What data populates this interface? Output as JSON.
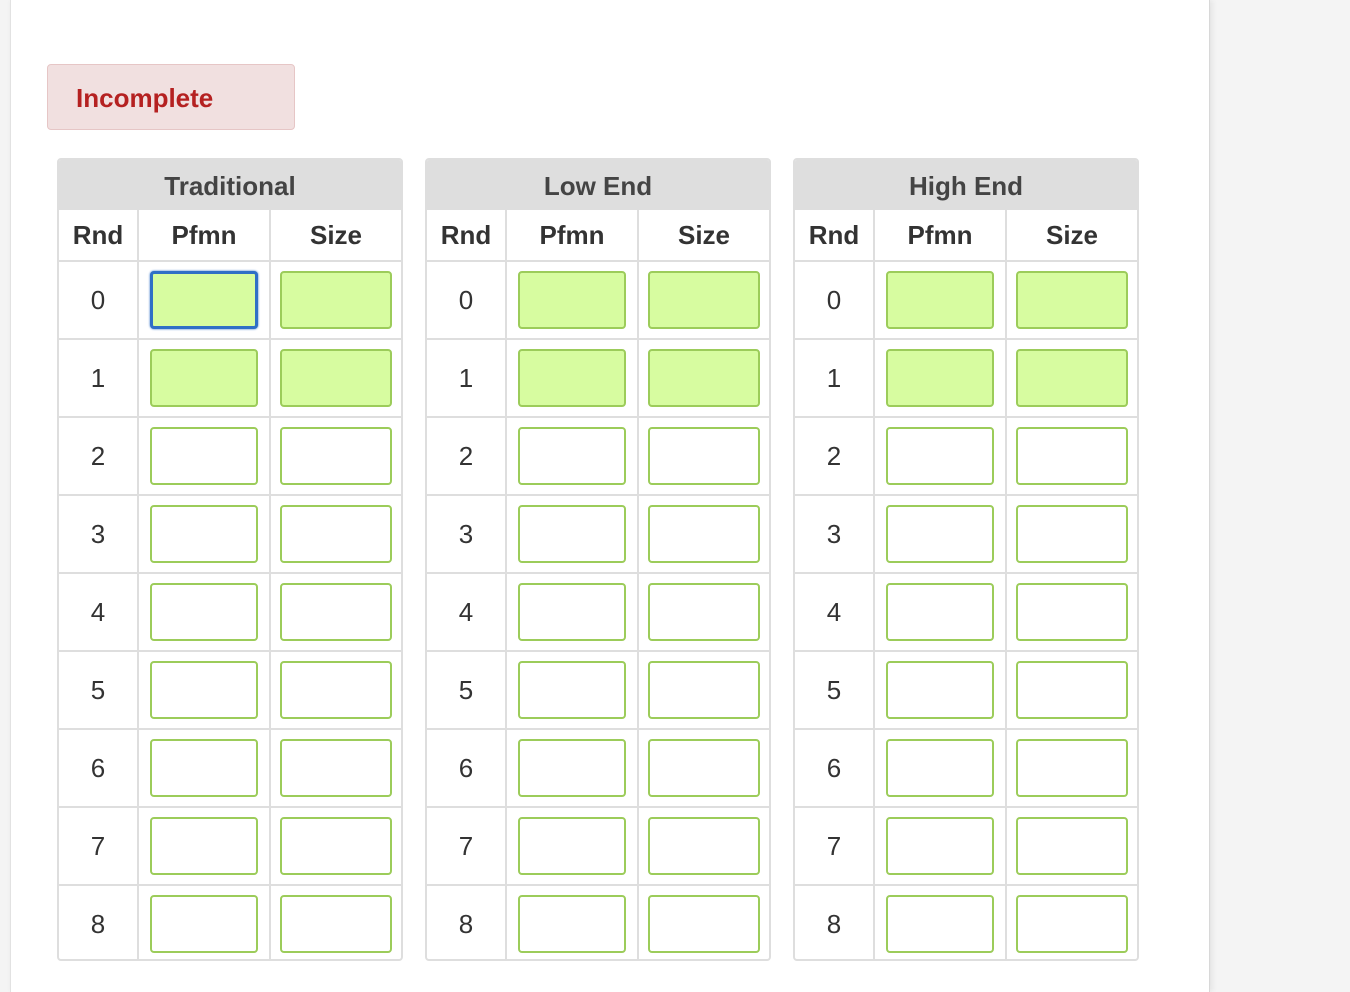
{
  "status": {
    "label": "Incomplete",
    "color": "#b52121"
  },
  "column_headers": {
    "rnd": "Rnd",
    "pfmn": "Pfmn",
    "size": "Size"
  },
  "segments": [
    {
      "title": "Traditional",
      "rows": [
        {
          "rnd": "0",
          "pfmn": "",
          "size": "",
          "highlighted": true,
          "focused_field": "pfmn"
        },
        {
          "rnd": "1",
          "pfmn": "",
          "size": "",
          "highlighted": true
        },
        {
          "rnd": "2",
          "pfmn": "",
          "size": "",
          "highlighted": false
        },
        {
          "rnd": "3",
          "pfmn": "",
          "size": "",
          "highlighted": false
        },
        {
          "rnd": "4",
          "pfmn": "",
          "size": "",
          "highlighted": false
        },
        {
          "rnd": "5",
          "pfmn": "",
          "size": "",
          "highlighted": false
        },
        {
          "rnd": "6",
          "pfmn": "",
          "size": "",
          "highlighted": false
        },
        {
          "rnd": "7",
          "pfmn": "",
          "size": "",
          "highlighted": false
        },
        {
          "rnd": "8",
          "pfmn": "",
          "size": "",
          "highlighted": false
        }
      ]
    },
    {
      "title": "Low End",
      "rows": [
        {
          "rnd": "0",
          "pfmn": "",
          "size": "",
          "highlighted": true
        },
        {
          "rnd": "1",
          "pfmn": "",
          "size": "",
          "highlighted": true
        },
        {
          "rnd": "2",
          "pfmn": "",
          "size": "",
          "highlighted": false
        },
        {
          "rnd": "3",
          "pfmn": "",
          "size": "",
          "highlighted": false
        },
        {
          "rnd": "4",
          "pfmn": "",
          "size": "",
          "highlighted": false
        },
        {
          "rnd": "5",
          "pfmn": "",
          "size": "",
          "highlighted": false
        },
        {
          "rnd": "6",
          "pfmn": "",
          "size": "",
          "highlighted": false
        },
        {
          "rnd": "7",
          "pfmn": "",
          "size": "",
          "highlighted": false
        },
        {
          "rnd": "8",
          "pfmn": "",
          "size": "",
          "highlighted": false
        }
      ]
    },
    {
      "title": "High End",
      "rows": [
        {
          "rnd": "0",
          "pfmn": "",
          "size": "",
          "highlighted": true
        },
        {
          "rnd": "1",
          "pfmn": "",
          "size": "",
          "highlighted": true
        },
        {
          "rnd": "2",
          "pfmn": "",
          "size": "",
          "highlighted": false
        },
        {
          "rnd": "3",
          "pfmn": "",
          "size": "",
          "highlighted": false
        },
        {
          "rnd": "4",
          "pfmn": "",
          "size": "",
          "highlighted": false
        },
        {
          "rnd": "5",
          "pfmn": "",
          "size": "",
          "highlighted": false
        },
        {
          "rnd": "6",
          "pfmn": "",
          "size": "",
          "highlighted": false
        },
        {
          "rnd": "7",
          "pfmn": "",
          "size": "",
          "highlighted": false
        },
        {
          "rnd": "8",
          "pfmn": "",
          "size": "",
          "highlighted": false
        }
      ]
    }
  ],
  "colors": {
    "highlight_fill": "#d7fca0",
    "input_border": "#9ccc5a",
    "focus_border": "#2f6fc6"
  }
}
